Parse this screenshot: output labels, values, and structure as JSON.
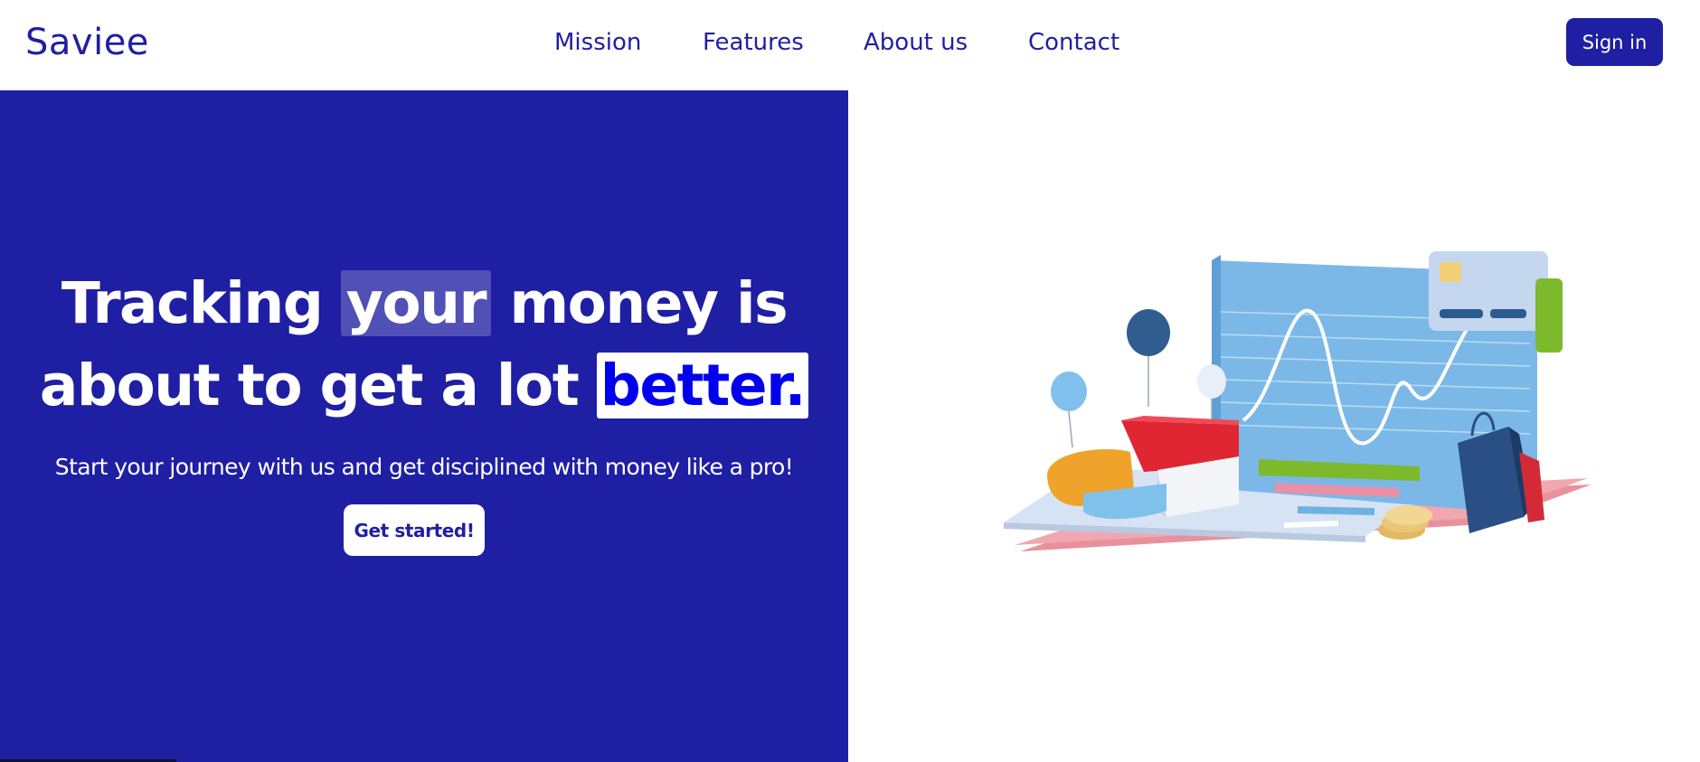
{
  "header": {
    "logo": "Saviee",
    "nav": [
      "Mission",
      "Features",
      "About us",
      "Contact"
    ],
    "signin_label": "Sign in"
  },
  "hero": {
    "headline": {
      "line1_a": "Tracking ",
      "line1_highlight": "your",
      "line1_b": " money is",
      "line2_a": "about to get a lot ",
      "line2_highlight": "better."
    },
    "subtitle": "Start your journey with us and get disciplined with money like a pro!",
    "cta_label": "Get started!"
  },
  "colors": {
    "brand": "#1f1fa3",
    "highlight_text": "#0000ee",
    "white": "#ffffff"
  },
  "illustration": {
    "icon": "finance-dashboard-illustration"
  }
}
